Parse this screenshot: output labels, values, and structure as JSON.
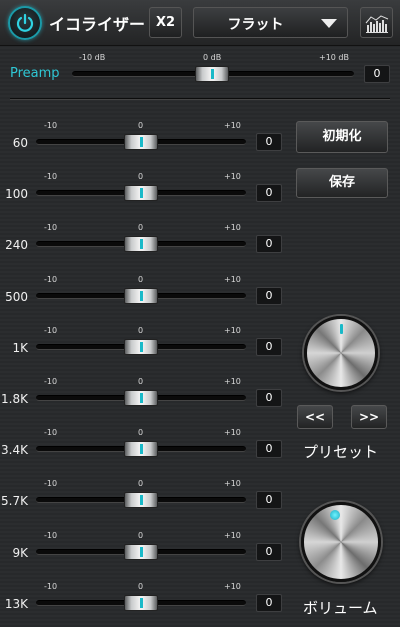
{
  "header": {
    "title": "イコライザー",
    "x2_label": "X2",
    "preset_selected": "フラット",
    "power_icon": "power-icon",
    "visualizer_icon": "equalizer-bars-icon"
  },
  "preamp": {
    "label": "Preamp",
    "tick_min": "-10 dB",
    "tick_mid": "0 dB",
    "tick_max": "+10 dB",
    "value": "0"
  },
  "bands": [
    {
      "label": "60",
      "value": "0",
      "tick_min": "-10",
      "tick_mid": "0",
      "tick_max": "+10"
    },
    {
      "label": "100",
      "value": "0",
      "tick_min": "-10",
      "tick_mid": "0",
      "tick_max": "+10"
    },
    {
      "label": "240",
      "value": "0",
      "tick_min": "-10",
      "tick_mid": "0",
      "tick_max": "+10"
    },
    {
      "label": "500",
      "value": "0",
      "tick_min": "-10",
      "tick_mid": "0",
      "tick_max": "+10"
    },
    {
      "label": "1K",
      "value": "0",
      "tick_min": "-10",
      "tick_mid": "0",
      "tick_max": "+10"
    },
    {
      "label": "1.8K",
      "value": "0",
      "tick_min": "-10",
      "tick_mid": "0",
      "tick_max": "+10"
    },
    {
      "label": "3.4K",
      "value": "0",
      "tick_min": "-10",
      "tick_mid": "0",
      "tick_max": "+10"
    },
    {
      "label": "5.7K",
      "value": "0",
      "tick_min": "-10",
      "tick_mid": "0",
      "tick_max": "+10"
    },
    {
      "label": "9K",
      "value": "0",
      "tick_min": "-10",
      "tick_mid": "0",
      "tick_max": "+10"
    },
    {
      "label": "13K",
      "value": "0",
      "tick_min": "-10",
      "tick_mid": "0",
      "tick_max": "+10"
    }
  ],
  "side": {
    "reset_label": "初期化",
    "save_label": "保存",
    "prev_label": "<<",
    "next_label": ">>",
    "preset_knob_label": "プリセット",
    "volume_knob_label": "ボリューム"
  },
  "colors": {
    "accent": "#19b9c8",
    "background": "#2a2c2e"
  }
}
